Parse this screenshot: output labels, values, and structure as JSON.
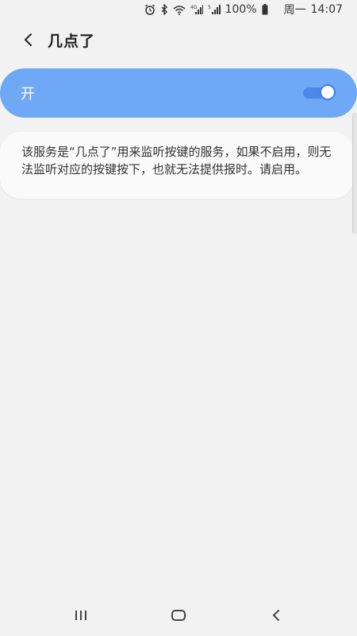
{
  "status_bar": {
    "battery": "100%",
    "weekday": "周一",
    "time": "14:07",
    "network_label_1": "4G",
    "network_label_2": "5"
  },
  "header": {
    "title": "几点了"
  },
  "toggle": {
    "label": "开",
    "state": "on",
    "bar_color": "#6fa9f5",
    "accent": "#3a7fe6"
  },
  "description": {
    "text": "该服务是“几点了”用来监听按键的服务，如果不启用，则无法监听对应的按键按下，也就无法提供报时。请启用。"
  },
  "nav": {
    "icons": [
      "recent-apps-icon",
      "home-icon",
      "back-icon"
    ]
  }
}
